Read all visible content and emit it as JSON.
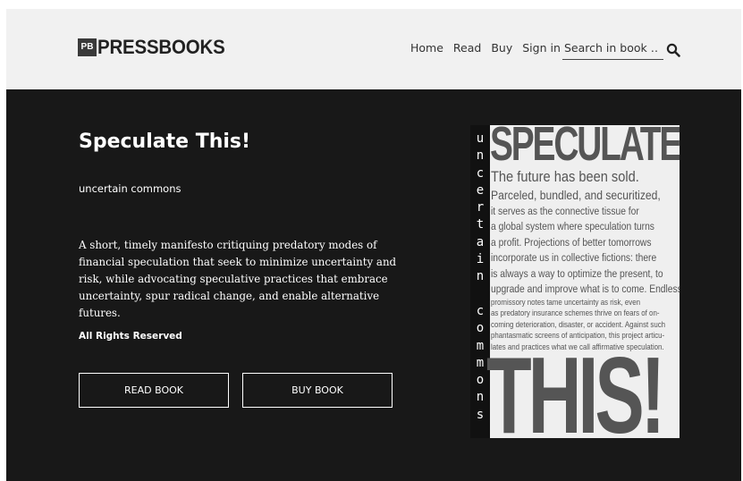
{
  "brand": {
    "logo_mark": "PB",
    "logo_text": "PRESSBOOKS"
  },
  "nav": {
    "home": "Home",
    "read": "Read",
    "buy": "Buy",
    "sign_in": "Sign in",
    "search_placeholder": "Search in book …",
    "search_icon": "search-icon"
  },
  "book": {
    "title": "Speculate This!",
    "author": "uncertain commons",
    "description": "A short, timely manifesto critiquing predatory modes of financial speculation that seek to minimize uncertainty and risk, while advocating speculative practices that embrace uncertainty, spur radical change, and enable alternative futures.",
    "rights": "All Rights Reserved",
    "read_button": "READ BOOK",
    "buy_button": "BUY BOOK"
  },
  "cover": {
    "side_text": "uncertain commons",
    "top_word": "SPECULATE",
    "lead": "The future has been sold.",
    "body_lines_large": [
      "Parceled, bundled, and securitized,",
      "it serves as the connective tissue for",
      "a global system where speculation turns",
      "a profit. Projections of better tomorrows",
      "incorporate us in collective fictions: there",
      "is always a way to optimize the present, to",
      "upgrade and improve what is to come. Endless"
    ],
    "body_lines_small": [
      "promissory notes tame uncertainty as risk, even",
      "as predatory insurance schemes thrive on fears of on-",
      "coming deterioration, disaster, or accident. Against such",
      "phantasmatic screens of anticipation, this project articu-",
      "lates and practices what we call affirmative speculation."
    ],
    "bottom_word": "THIS!"
  }
}
